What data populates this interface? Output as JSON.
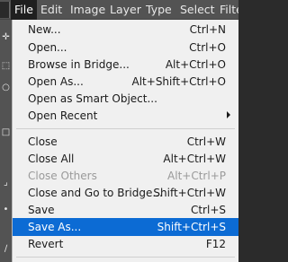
{
  "menubar": {
    "items": [
      "File",
      "Edit",
      "Image",
      "Layer",
      "Type",
      "Select",
      "Filte"
    ]
  },
  "file_menu": {
    "items": [
      {
        "label": "New...",
        "shortcut": "Ctrl+N"
      },
      {
        "label": "Open...",
        "shortcut": "Ctrl+O"
      },
      {
        "label": "Browse in Bridge...",
        "shortcut": "Alt+Ctrl+O"
      },
      {
        "label": "Open As...",
        "shortcut": "Alt+Shift+Ctrl+O"
      },
      {
        "label": "Open as Smart Object...",
        "shortcut": ""
      },
      {
        "label": "Open Recent",
        "shortcut": "",
        "submenu": true
      },
      {
        "label": "Close",
        "shortcut": "Ctrl+W"
      },
      {
        "label": "Close All",
        "shortcut": "Alt+Ctrl+W"
      },
      {
        "label": "Close Others",
        "shortcut": "Alt+Ctrl+P",
        "disabled": true
      },
      {
        "label": "Close and Go to Bridge...",
        "shortcut": "Shift+Ctrl+W"
      },
      {
        "label": "Save",
        "shortcut": "Ctrl+S"
      },
      {
        "label": "Save As...",
        "shortcut": "Shift+Ctrl+S",
        "highlighted": true
      },
      {
        "label": "Revert",
        "shortcut": "F12"
      }
    ]
  },
  "icons": {
    "tools": [
      "move-tool-icon",
      "marquee-tool-icon",
      "lasso-tool-icon",
      "quick-select-tool-icon",
      "crop-tool-icon",
      "eyedropper-tool-icon",
      "brush-tool-icon"
    ],
    "submenu": "chevron-right-icon"
  },
  "colors": {
    "highlight": "#0c6bd4",
    "menu_background": "#f0f0f0",
    "menubar_background": "#535353",
    "disabled_text": "#9a9a9a"
  }
}
